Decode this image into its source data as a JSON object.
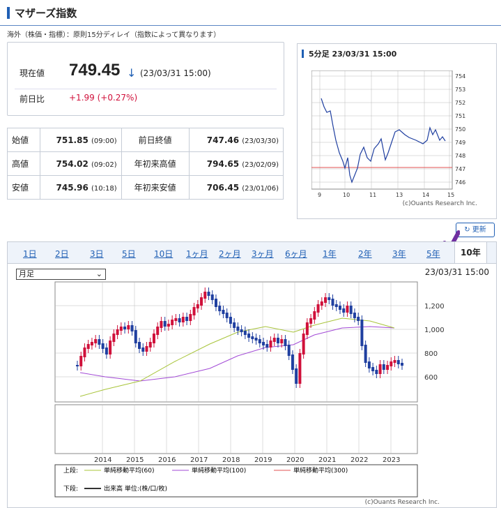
{
  "header": {
    "title": "マザーズ指数",
    "notice": "海外（株価・指標）：原則15分ディレイ（指数によって異なります）"
  },
  "price": {
    "label": "現在値",
    "value": "749.45",
    "arrow": "↓",
    "time": "(23/03/31 15:00)",
    "change_label": "前日比",
    "change": "+1.99 (+0.27%)"
  },
  "quotes": [
    {
      "l1": "始値",
      "v1": "751.85",
      "t1": "(09:00)",
      "l2": "前日終値",
      "v2": "747.46",
      "t2": "(23/03/30)"
    },
    {
      "l1": "高値",
      "v1": "754.02",
      "t1": "(09:02)",
      "l2": "年初来高値",
      "v2": "794.65",
      "t2": "(23/02/09)"
    },
    {
      "l1": "安値",
      "v1": "745.96",
      "t1": "(10:18)",
      "l2": "年初来安値",
      "v2": "706.45",
      "t2": "(23/01/06)"
    }
  ],
  "mini_chart": {
    "title": "5分足 23/03/31 15:00",
    "credit": "(c)Ouants Research Inc.",
    "y_ticks": [
      "754",
      "753",
      "752",
      "751",
      "750",
      "749",
      "748",
      "747",
      "746"
    ],
    "x_ticks": [
      "9",
      "10",
      "11",
      "13",
      "14",
      "15"
    ]
  },
  "refresh_label": "更新",
  "tabs": [
    "1日",
    "2日",
    "3日",
    "5日",
    "10日",
    "1ヶ月",
    "2ヶ月",
    "3ヶ月",
    "6ヶ月",
    "1年",
    "2年",
    "3年",
    "5年",
    "10年"
  ],
  "select": {
    "value": "月足"
  },
  "main_chart": {
    "timestamp": "23/03/31 15:00",
    "y_ticks": [
      "1,200",
      "1,000",
      "800",
      "600"
    ],
    "x_ticks": [
      "2014",
      "2015",
      "2016",
      "2017",
      "2018",
      "2019",
      "2020",
      "2021",
      "2022",
      "2023"
    ],
    "legend_upper": "上段:",
    "ma60": "単純移動平均(60)",
    "ma100": "単純移動平均(100)",
    "ma300": "単純移動平均(300)",
    "legend_lower": "下段:",
    "volume": "出来高 単位:(株/口/枚)",
    "credit": "(c)Ouants Research Inc."
  },
  "colors": {
    "accent": "#1f5fb4",
    "up": "#d0103a",
    "down": "#1f3fa0",
    "ma60": "#a8c43a",
    "ma100": "#a24ad6",
    "ma300": "#e05050"
  },
  "chart_data": {
    "type": "line",
    "title": "5分足 23/03/31 15:00",
    "x": [
      "9",
      "10",
      "11",
      "13",
      "14",
      "15"
    ],
    "series": [
      {
        "values": [
          751.8,
          749,
          747,
          746,
          749,
          750.3,
          749.6,
          749.4
        ]
      }
    ],
    "ylim": [
      746,
      754
    ]
  }
}
